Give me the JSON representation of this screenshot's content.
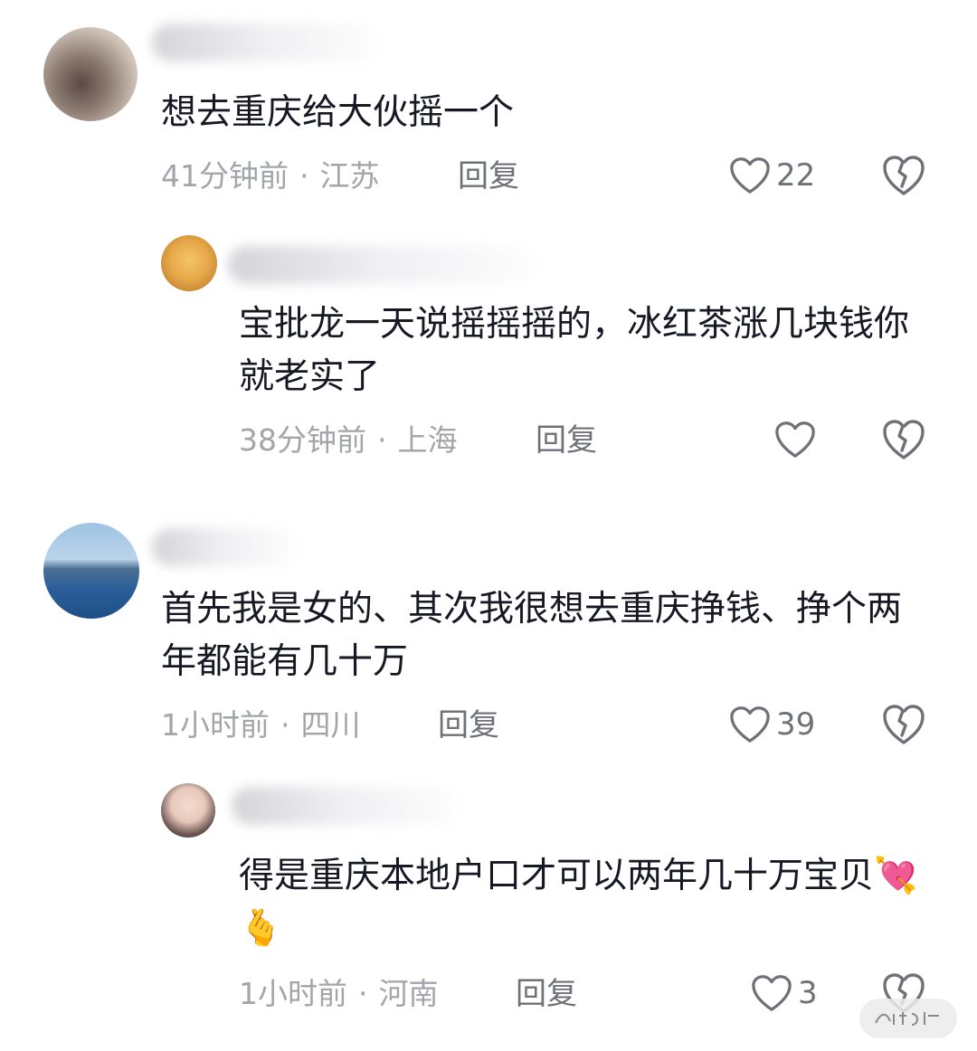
{
  "comments": [
    {
      "content": "想去重庆给大伙摇一个",
      "time": "41分钟前",
      "location": "江苏",
      "reply_label": "回复",
      "likes": "22"
    },
    {
      "content": "宝批龙一天说摇摇摇的，冰红茶涨几块钱你就老实了",
      "time": "38分钟前",
      "location": "上海",
      "reply_label": "回复",
      "likes": ""
    },
    {
      "content": "首先我是女的、其次我很想去重庆挣钱、挣个两年都能有几十万",
      "time": "1小时前",
      "location": "四川",
      "reply_label": "回复",
      "likes": "39"
    },
    {
      "content": "得是重庆本地户口才可以两年几十万宝贝💘🫰",
      "time": "1小时前",
      "location": "河南",
      "reply_label": "回复",
      "likes": "3"
    }
  ],
  "meta_separator": "·",
  "colors": {
    "text": "#161823",
    "meta": "#a4a5aa",
    "icon": "#6f7078"
  }
}
